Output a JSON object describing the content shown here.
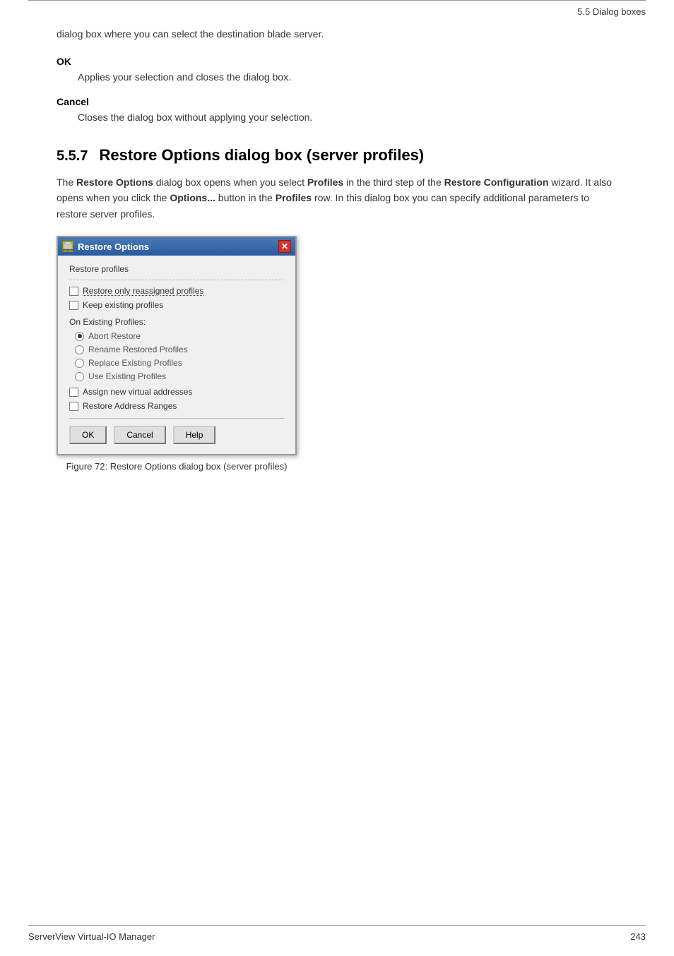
{
  "header": {
    "rule": true,
    "section": "5.5 Dialog boxes"
  },
  "intro": {
    "text": "dialog box where you can select the destination blade server."
  },
  "ok_section": {
    "term": "OK",
    "desc": "Applies your selection and closes the dialog box."
  },
  "cancel_section": {
    "term": "Cancel",
    "desc": "Closes the dialog box without applying your selection."
  },
  "section": {
    "number": "5.5.7",
    "title": "Restore Options dialog box (server profiles)",
    "desc_parts": [
      "The ",
      "Restore Options",
      " dialog box opens when you select ",
      "Profiles",
      " in the third step of the ",
      "Restore Configuration",
      " wizard. It also opens when you click the ",
      "Options...",
      " button in the ",
      "Profiles",
      " row. In this dialog box you can specify additional parameters to restore server profiles."
    ]
  },
  "dialog": {
    "title": "Restore Options",
    "title_icon": "🖥",
    "close_btn": "✕",
    "restore_profiles_label": "Restore profiles",
    "checkbox1": {
      "label": "Restore only reassigned profiles",
      "checked": false,
      "underline": true
    },
    "checkbox2": {
      "label": "Keep existing profiles",
      "checked": false
    },
    "on_existing_label": "On Existing Profiles:",
    "radio_options": [
      {
        "label": "Abort Restore",
        "selected": true
      },
      {
        "label": "Rename Restored Profiles",
        "selected": false
      },
      {
        "label": "Replace Existing Profiles",
        "selected": false
      },
      {
        "label": "Use Existing Profiles",
        "selected": false
      }
    ],
    "checkbox3": {
      "label": "Assign new virtual addresses",
      "checked": false
    },
    "checkbox4": {
      "label": "Restore Address Ranges",
      "checked": false
    },
    "buttons": {
      "ok": "OK",
      "cancel": "Cancel",
      "help": "Help"
    }
  },
  "figure_caption": "Figure 72: Restore Options dialog box (server profiles)",
  "footer": {
    "left": "ServerView Virtual-IO Manager",
    "right": "243"
  }
}
